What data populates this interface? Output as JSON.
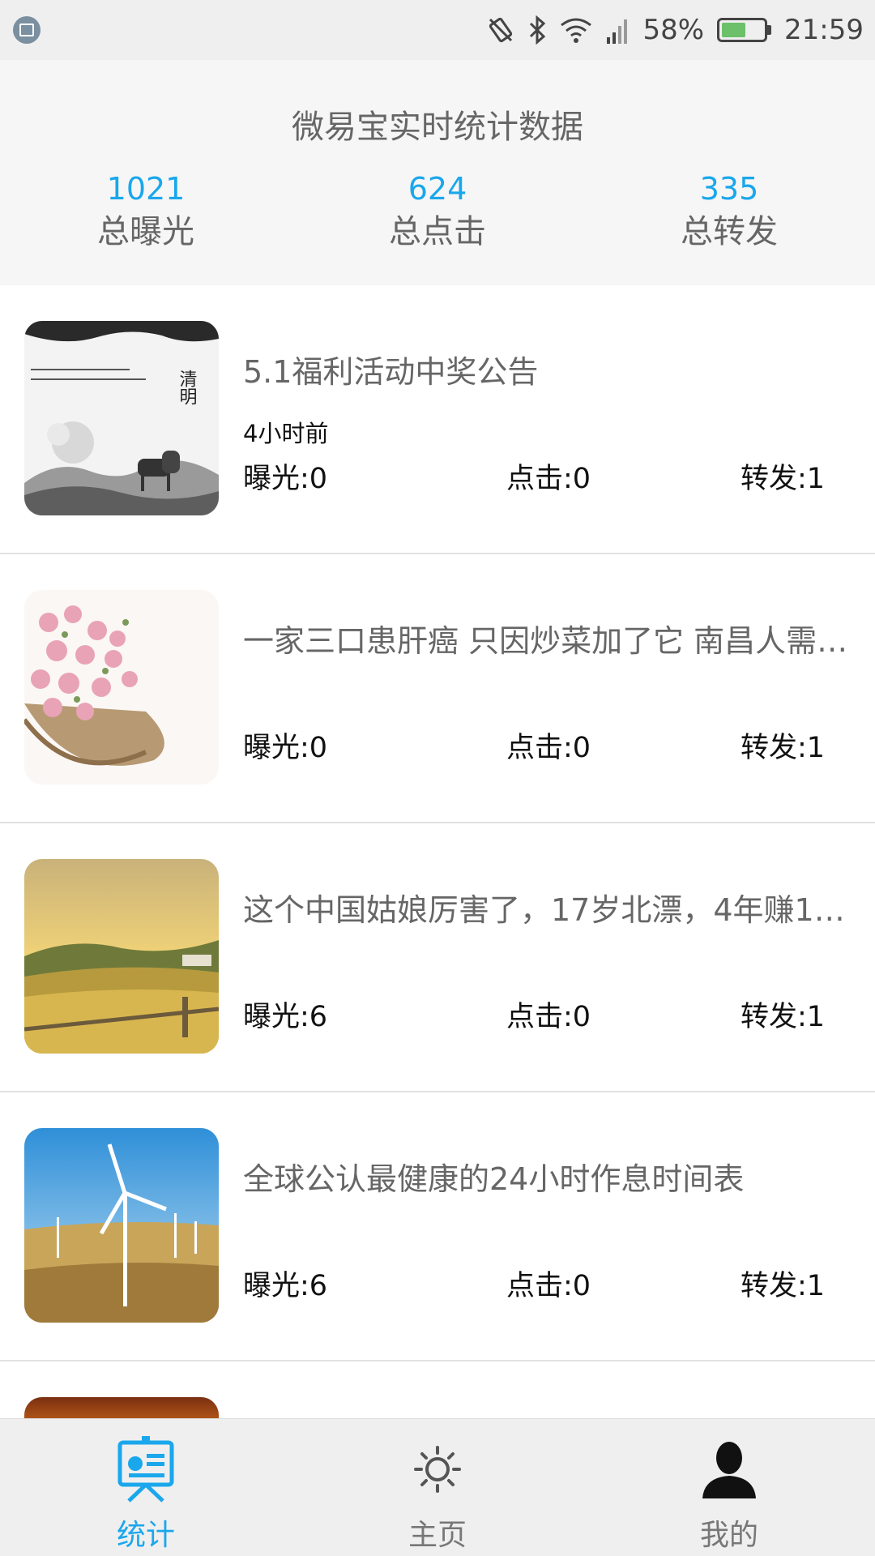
{
  "status_bar": {
    "battery": "58%",
    "battery_level": 0.58,
    "time": "21:59"
  },
  "header": {
    "title": "微易宝实时统计数据",
    "stats": [
      {
        "value": "1021",
        "label": "总曝光"
      },
      {
        "value": "624",
        "label": "总点击"
      },
      {
        "value": "335",
        "label": "总转发"
      }
    ]
  },
  "articles": [
    {
      "title": "5.1福利活动中奖公告",
      "time": "4小时前",
      "exposure": "曝光:0",
      "clicks": "点击:0",
      "forwards": "转发:1",
      "thumb_watermark": "清明"
    },
    {
      "title": "一家三口患肝癌 只因炒菜加了它 南昌人需…",
      "time": "",
      "exposure": "曝光:0",
      "clicks": "点击:0",
      "forwards": "转发:1"
    },
    {
      "title": "这个中国姑娘厉害了，17岁北漂，4年赚1.…",
      "time": "",
      "exposure": "曝光:6",
      "clicks": "点击:0",
      "forwards": "转发:1"
    },
    {
      "title": "全球公认最健康的24小时作息时间表",
      "time": "",
      "exposure": "曝光:6",
      "clicks": "点击:0",
      "forwards": "转发:1"
    }
  ],
  "bottom_nav": {
    "items": [
      {
        "label": "统计",
        "icon": "presentation-chart-icon",
        "active": true
      },
      {
        "label": "主页",
        "icon": "sun-icon",
        "active": false
      },
      {
        "label": "我的",
        "icon": "user-silhouette-icon",
        "active": false
      }
    ]
  },
  "colors": {
    "accent": "#1aa7ec",
    "header_bg": "#f6f6f6",
    "status_bar_bg": "#efefef",
    "nav_inactive": "#777777"
  }
}
